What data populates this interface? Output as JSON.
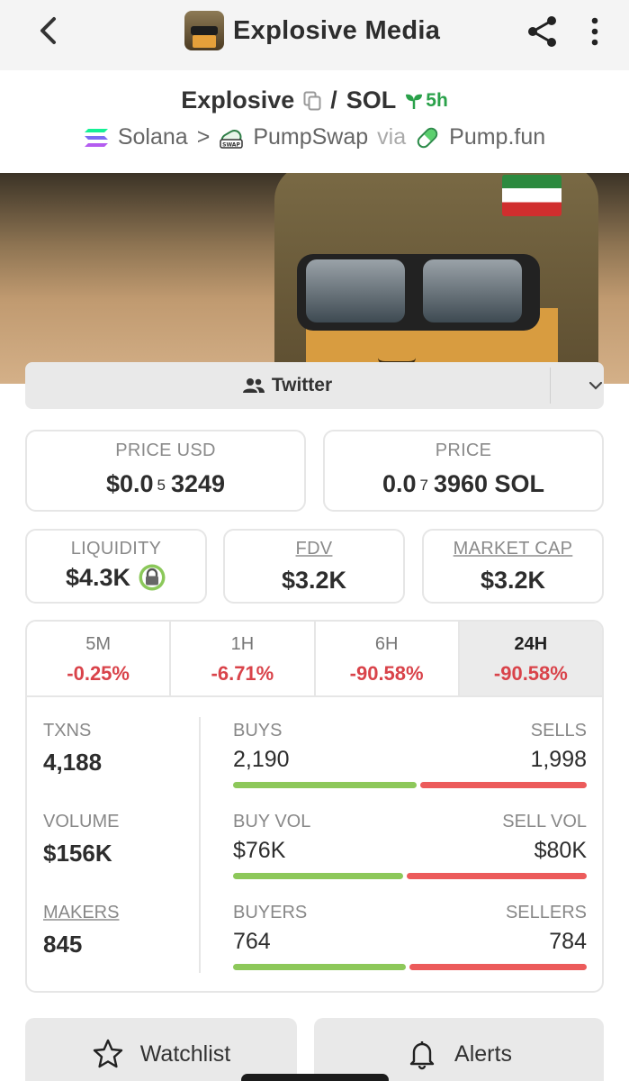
{
  "header": {
    "title": "Explosive Media"
  },
  "pair": {
    "base": "Explosive",
    "separator": "/",
    "quote": "SOL",
    "age": "5h"
  },
  "route": {
    "chain": "Solana",
    "arrow": ">",
    "dex": "PumpSwap",
    "via": "via",
    "launchpad": "Pump.fun"
  },
  "links": {
    "twitter": "Twitter"
  },
  "price_usd": {
    "label": "PRICE USD",
    "prefix": "$0.0",
    "zeros": "5",
    "digits": "3249"
  },
  "price_native": {
    "label": "PRICE",
    "prefix": "0.0",
    "zeros": "7",
    "digits": "3960 SOL"
  },
  "liquidity": {
    "label": "LIQUIDITY",
    "value": "$4.3K"
  },
  "fdv": {
    "label": "FDV",
    "value": "$3.2K"
  },
  "market_cap": {
    "label": "MARKET CAP",
    "value": "$3.2K"
  },
  "timeframes": [
    {
      "label": "5M",
      "change": "-0.25%"
    },
    {
      "label": "1H",
      "change": "-6.71%"
    },
    {
      "label": "6H",
      "change": "-90.58%"
    },
    {
      "label": "24H",
      "change": "-90.58%"
    }
  ],
  "stats": {
    "txns": {
      "label": "TXNS",
      "value": "4,188"
    },
    "volume": {
      "label": "VOLUME",
      "value": "$156K"
    },
    "makers": {
      "label": "MAKERS",
      "value": "845"
    },
    "buys": {
      "left_label": "BUYS",
      "left_value": "2,190",
      "right_label": "SELLS",
      "right_value": "1,998",
      "buy_share": 0.523
    },
    "vol": {
      "left_label": "BUY VOL",
      "left_value": "$76K",
      "right_label": "SELL VOL",
      "right_value": "$80K",
      "buy_share": 0.487
    },
    "buyers": {
      "left_label": "BUYERS",
      "left_value": "764",
      "right_label": "SELLERS",
      "right_value": "784",
      "buy_share": 0.494
    }
  },
  "actions": {
    "watchlist": "Watchlist",
    "alerts": "Alerts"
  },
  "colors": {
    "buy": "#8dc85a",
    "sell": "#ec5b5b",
    "negative": "#d9434a",
    "age": "#2aa14a"
  }
}
